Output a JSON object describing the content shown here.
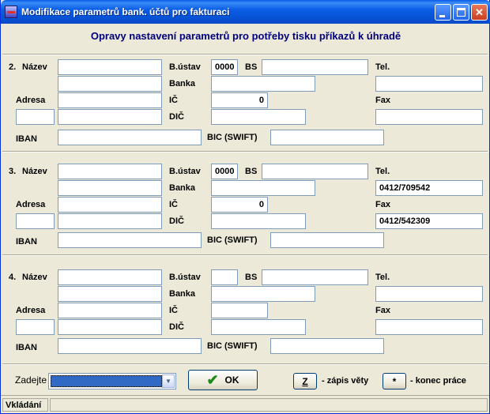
{
  "window": {
    "title": "Modifikace parametrů bank. účtů pro fakturaci",
    "subtitle": "Opravy nastavení parametrů pro potřeby tisku příkazů k úhradě"
  },
  "labels": {
    "nazev_suffix": "Název",
    "bustav": "B.ústav",
    "bs": "BS",
    "tel": "Tel.",
    "banka": "Banka",
    "adresa": "Adresa",
    "ic": "IČ",
    "fax": "Fax",
    "dic": "DIČ",
    "iban": "IBAN",
    "bic": "BIC (SWIFT)"
  },
  "sections": [
    {
      "number": "2.",
      "bustav": "0000",
      "ic": "0",
      "tel": "",
      "fax": ""
    },
    {
      "number": "3.",
      "bustav": "0000",
      "ic": "0",
      "tel": "0412/709542",
      "fax": "0412/542309"
    },
    {
      "number": "4.",
      "bustav": "",
      "ic": "",
      "tel": "",
      "fax": ""
    }
  ],
  "bottom": {
    "zadejte_label": "Zadejte",
    "ok_label": "OK",
    "z_key": "Z",
    "z_desc": "- zápis věty",
    "star_key": "*",
    "star_desc": "- konec práce"
  },
  "status": {
    "text": "Vkládání"
  }
}
